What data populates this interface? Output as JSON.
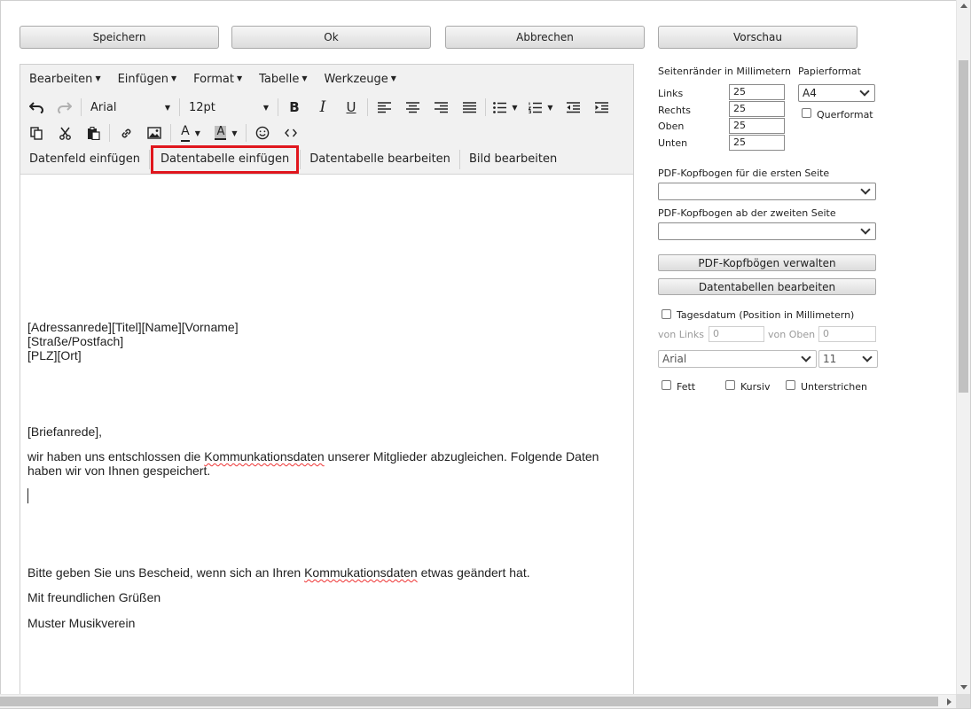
{
  "top_buttons": {
    "save": "Speichern",
    "ok": "Ok",
    "cancel": "Abbrechen",
    "preview": "Vorschau"
  },
  "menu": [
    "Bearbeiten",
    "Einfügen",
    "Format",
    "Tabelle",
    "Werkzeuge"
  ],
  "toolbar": {
    "font_family": "Arial",
    "font_size": "12pt",
    "icons": {
      "undo": "undo-icon",
      "redo": "redo-icon",
      "bold": "bold-icon",
      "italic": "italic-icon",
      "underline": "underline-icon",
      "align_left": "align-left-icon",
      "align_center": "align-center-icon",
      "align_right": "align-right-icon",
      "justify": "justify-icon",
      "bullet_list": "bullet-list-icon",
      "numbered_list": "numbered-list-icon",
      "outdent": "outdent-icon",
      "indent": "indent-icon",
      "copy": "copy-icon",
      "cut": "cut-icon",
      "paste": "paste-icon",
      "link": "link-icon",
      "image": "image-icon",
      "text_color": "text-color-icon",
      "background_color": "background-color-icon",
      "emoji": "emoji-icon",
      "source_code": "source-code-icon"
    },
    "glyphs": {
      "bold": "B",
      "italic": "I",
      "underline": "U",
      "text_color": "A",
      "background_color": "A"
    }
  },
  "custom_buttons": [
    "Datenfeld einfügen",
    "Datentabelle einfügen",
    "Datentabelle bearbeiten",
    "Bild bearbeiten"
  ],
  "highlight_color": "#e0161d",
  "document": {
    "address_line1": "[Adressanrede][Titel][Name][Vorname]",
    "address_line2": "[Straße/Postfach]",
    "address_line3": "[PLZ][Ort]",
    "salutation": "[Briefanrede],",
    "body1_before": "wir haben uns entschlossen die ",
    "body1_misspelled": "Kommunkationsdaten",
    "body1_after": " unserer Mitglieder abzugleichen. Folgende Daten haben wir von Ihnen gespeichert.",
    "body2_before": "Bitte geben Sie uns Bescheid, wenn sich an Ihren ",
    "body2_misspelled": "Kommukationsdaten",
    "body2_after": " etwas geändert hat.",
    "closing": "Mit freundlichen Grüßen",
    "sender": "Muster Musikverein"
  },
  "settings": {
    "margins_title": "Seitenränder in Millimetern",
    "paper_title": "Papierformat",
    "margins": [
      {
        "label": "Links",
        "value": "25"
      },
      {
        "label": "Rechts",
        "value": "25"
      },
      {
        "label": "Oben",
        "value": "25"
      },
      {
        "label": "Unten",
        "value": "25"
      }
    ],
    "paper_format": "A4",
    "landscape_label": "Querformat",
    "letterhead_first_label": "PDF-Kopfbogen für die ersten Seite",
    "letterhead_first_value": "",
    "letterhead_second_label": "PDF-Kopfbogen ab der zweiten Seite",
    "letterhead_second_value": "",
    "manage_letterheads": "PDF-Kopfbögen verwalten",
    "edit_datatables": "Datentabellen bearbeiten",
    "date_label": "Tagesdatum (Position in Millimetern)",
    "from_left_label": "von Links",
    "from_left_value": "0",
    "from_top_label": "von Oben",
    "from_top_value": "0",
    "date_font": "Arial",
    "date_font_size": "11",
    "bold_label": "Fett",
    "italic_label": "Kursiv",
    "underline_label": "Unterstrichen"
  }
}
